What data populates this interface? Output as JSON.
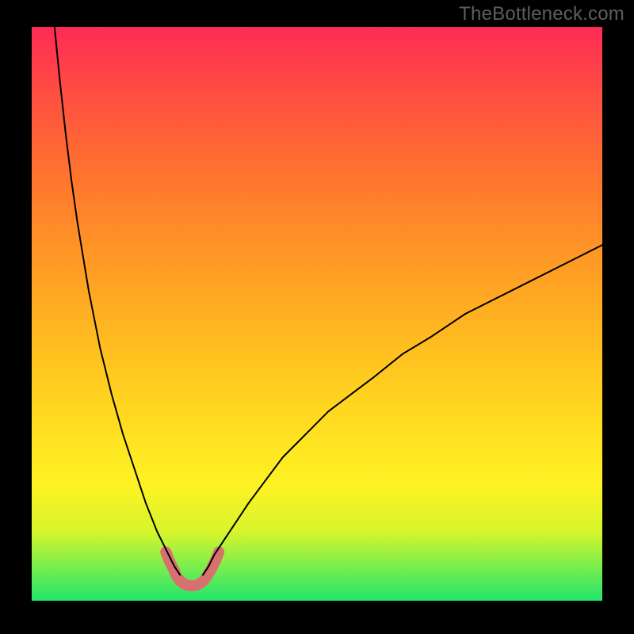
{
  "watermark": "TheBottleneck.com",
  "chart_data": {
    "type": "line",
    "title": "",
    "xlabel": "",
    "ylabel": "",
    "xlim": [
      0,
      100
    ],
    "ylim": [
      0,
      100
    ],
    "bottleneck_x": 28,
    "gradient_colors": {
      "top": "#ff2b56",
      "upper_mid": "#ffab22",
      "mid": "#fef224",
      "lower_mid": "#d7f52c",
      "bottom": "#22e56e"
    },
    "series": [
      {
        "name": "curve-left",
        "color": "#000000",
        "width": 2,
        "x": [
          4,
          5,
          6,
          7,
          8,
          10,
          12,
          14,
          16,
          18,
          20,
          22,
          23,
          24,
          25,
          26
        ],
        "y": [
          100,
          90,
          81,
          73,
          66,
          54,
          44,
          36,
          29,
          23,
          17,
          12,
          10,
          8,
          6,
          4.5
        ]
      },
      {
        "name": "curve-right",
        "color": "#000000",
        "width": 2,
        "x": [
          30,
          31,
          32,
          34,
          36,
          38,
          41,
          44,
          48,
          52,
          56,
          60,
          65,
          70,
          76,
          82,
          88,
          94,
          100
        ],
        "y": [
          4.5,
          6,
          8,
          11,
          14,
          17,
          21,
          25,
          29,
          33,
          36,
          39,
          43,
          46,
          50,
          53,
          56,
          59,
          62
        ]
      },
      {
        "name": "marker-valley",
        "color": "#d97070",
        "width": 14,
        "x": [
          23.5,
          24,
          24.5,
          25,
          25.3,
          25.8,
          26.3,
          26.8,
          27.3,
          27.8,
          28.3,
          28.8,
          29.3,
          29.8,
          30.3,
          30.8,
          31.3,
          31.8,
          32.3,
          32.8
        ],
        "y": [
          8.5,
          7.2,
          6.2,
          5.2,
          4.4,
          3.7,
          3.2,
          2.9,
          2.7,
          2.6,
          2.6,
          2.7,
          2.9,
          3.2,
          3.7,
          4.4,
          5.2,
          6.2,
          7.2,
          8.5
        ]
      }
    ]
  }
}
